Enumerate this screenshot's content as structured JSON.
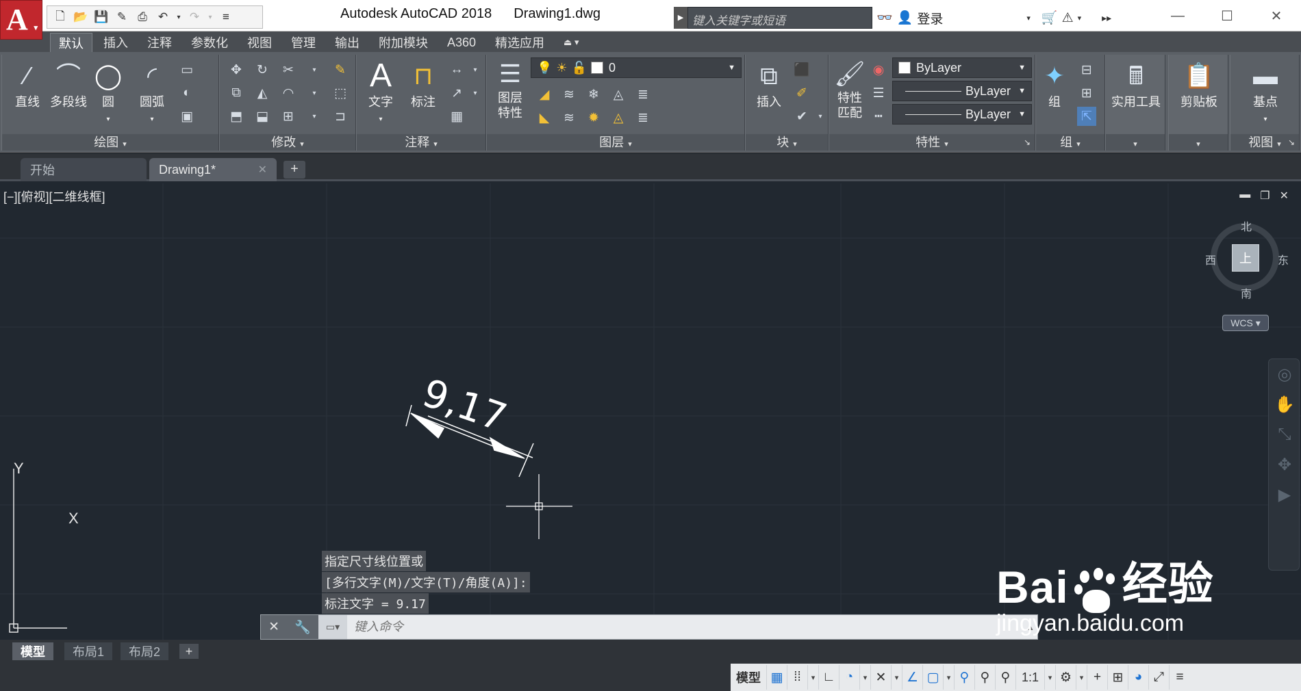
{
  "titlebar": {
    "app_name": "Autodesk AutoCAD 2018",
    "file_name": "Drawing1.dwg",
    "search_placeholder": "键入关键字或短语",
    "login_label": "登录"
  },
  "ribbon_tabs": [
    "默认",
    "插入",
    "注释",
    "参数化",
    "视图",
    "管理",
    "输出",
    "附加模块",
    "A360",
    "精选应用"
  ],
  "ribbon": {
    "draw": {
      "title": "绘图",
      "line": "直线",
      "polyline": "多段线",
      "circle": "圆",
      "arc": "圆弧"
    },
    "modify": {
      "title": "修改"
    },
    "annotation": {
      "title": "注释",
      "text": "文字",
      "dimension": "标注"
    },
    "layers": {
      "title": "图层",
      "properties_line1": "图层",
      "properties_line2": "特性",
      "current_layer": "0"
    },
    "block": {
      "title": "块",
      "insert": "插入"
    },
    "properties": {
      "title": "特性",
      "match_line1": "特性",
      "match_line2": "匹配",
      "color": "ByLayer",
      "linetype": "ByLayer",
      "lineweight": "ByLayer"
    },
    "groups": {
      "title": "组",
      "group": "组"
    },
    "utilities": {
      "label": "实用工具"
    },
    "clipboard": {
      "label": "剪贴板"
    },
    "view": {
      "title": "视图",
      "basepoint": "基点"
    }
  },
  "doc_tabs": {
    "start": "开始",
    "drawing": "Drawing1*"
  },
  "viewport": {
    "label": "[−][俯视][二维线框]",
    "compass": {
      "north": "北",
      "south": "南",
      "east": "东",
      "west": "西",
      "top": "上"
    },
    "wcs": "WCS",
    "dimension_text": "9,17",
    "ucs_x": "X",
    "ucs_y": "Y"
  },
  "command": {
    "history": [
      "指定尺寸线位置或",
      "[多行文字(M)/文字(T)/角度(A)]:",
      "标注文字 = 9.17"
    ],
    "placeholder": "键入命令"
  },
  "layout_tabs": [
    "模型",
    "布局1",
    "布局2"
  ],
  "statusbar": {
    "model": "模型",
    "scale": "1:1"
  },
  "watermark": {
    "brand_a": "Bai",
    "brand_b": "经验",
    "url": "jingyan.baidu.com"
  }
}
